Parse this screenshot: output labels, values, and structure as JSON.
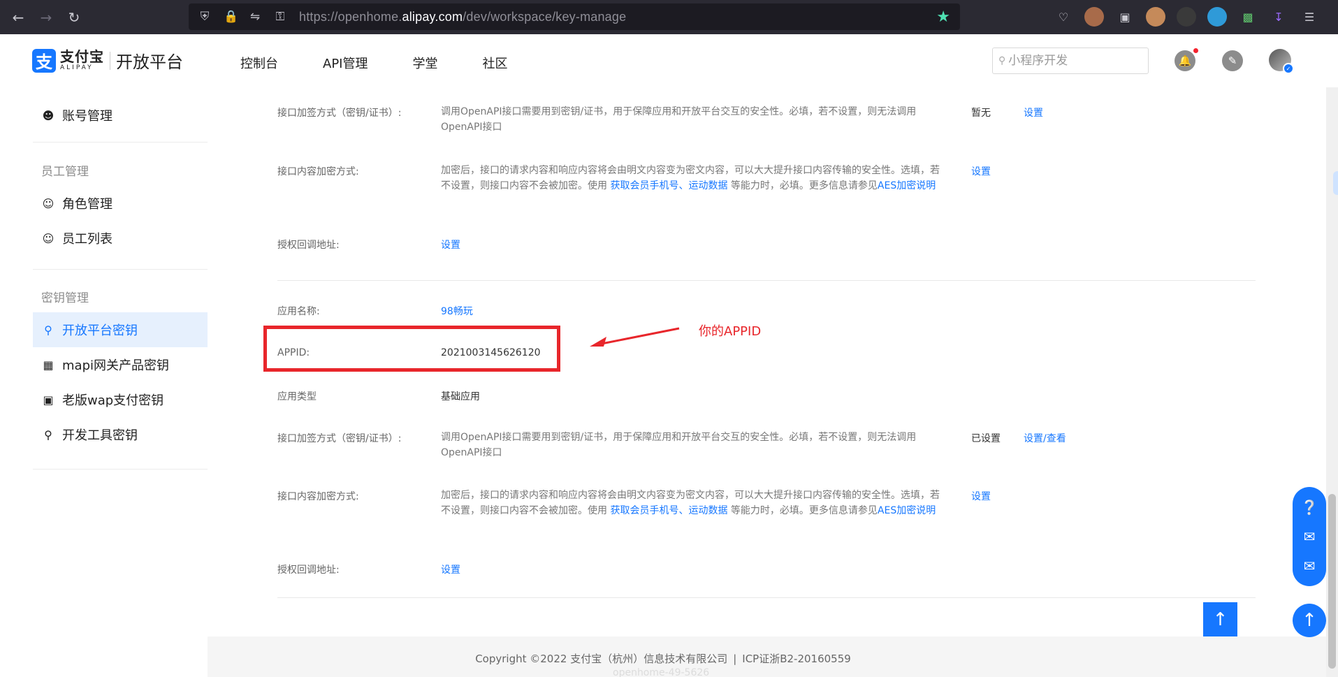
{
  "browser": {
    "url_prefix": "https://openhome.",
    "url_host": "alipay.com",
    "url_path": "/dev/workspace/key-manage"
  },
  "header": {
    "logo_cn": "支付宝",
    "logo_en": "ALIPAY",
    "platform": "开放平台",
    "nav": [
      "控制台",
      "API管理",
      "学堂",
      "社区"
    ],
    "search_placeholder": "小程序开发"
  },
  "sidebar": {
    "account": "账号管理",
    "group_staff": "员工管理",
    "role": "角色管理",
    "staff_list": "员工列表",
    "group_keys": "密钥管理",
    "items": [
      "开放平台密钥",
      "mapi网关产品密钥",
      "老版wap支付密钥",
      "开发工具密钥"
    ]
  },
  "section1": {
    "sign_label": "接口加签方式（密钥/证书）:",
    "sign_desc": "调用OpenAPI接口需要用到密钥/证书，用于保障应用和开放平台交互的安全性。必填，若不设置，则无法调用OpenAPI接口",
    "sign_status": "暂无",
    "sign_action": "设置",
    "encrypt_label": "接口内容加密方式:",
    "encrypt_desc_1": "加密后，接口的请求内容和响应内容将会由明文内容变为密文内容，可以大大提升接口内容传输的安全性。选填，若不设置，则接口内容不会被加密。使用 ",
    "encrypt_link_1": "获取会员手机号",
    "encrypt_sep": "、",
    "encrypt_link_2": "运动数据",
    "encrypt_desc_2": " 等能力时，必填。更多信息请参见",
    "encrypt_link_3": "AES加密说明",
    "encrypt_action": "设置",
    "callback_label": "授权回调地址:",
    "callback_action": "设置"
  },
  "section2": {
    "app_name_label": "应用名称:",
    "app_name": "98畅玩",
    "appid_label": "APPID:",
    "appid": "2021003145626120",
    "type_label": "应用类型",
    "type": "基础应用",
    "sign_label": "接口加签方式（密钥/证书）:",
    "sign_desc": "调用OpenAPI接口需要用到密钥/证书，用于保障应用和开放平台交互的安全性。必填，若不设置，则无法调用OpenAPI接口",
    "sign_status": "已设置",
    "sign_action": "设置/查看",
    "encrypt_label": "接口内容加密方式:",
    "encrypt_desc_1": "加密后，接口的请求内容和响应内容将会由明文内容变为密文内容，可以大大提升接口内容传输的安全性。选填，若不设置，则接口内容不会被加密。使用 ",
    "encrypt_link_1": "获取会员手机号",
    "encrypt_sep": "、",
    "encrypt_link_2": "运动数据",
    "encrypt_desc_2": " 等能力时，必填。更多信息请参见",
    "encrypt_link_3": "AES加密说明",
    "encrypt_action": "设置",
    "callback_label": "授权回调地址:",
    "callback_action": "设置"
  },
  "annotation": {
    "text": "你的APPID",
    "color": "#e8262b"
  },
  "footer": {
    "copyright": "Copyright ©2022 支付宝（杭州）信息技术有限公司",
    "divider": "|",
    "icp": "ICP证浙B2-20160559",
    "watermark": "openhome-49-5626"
  },
  "colors": {
    "accent": "#1677ff",
    "chrome": "#2b2a33"
  }
}
